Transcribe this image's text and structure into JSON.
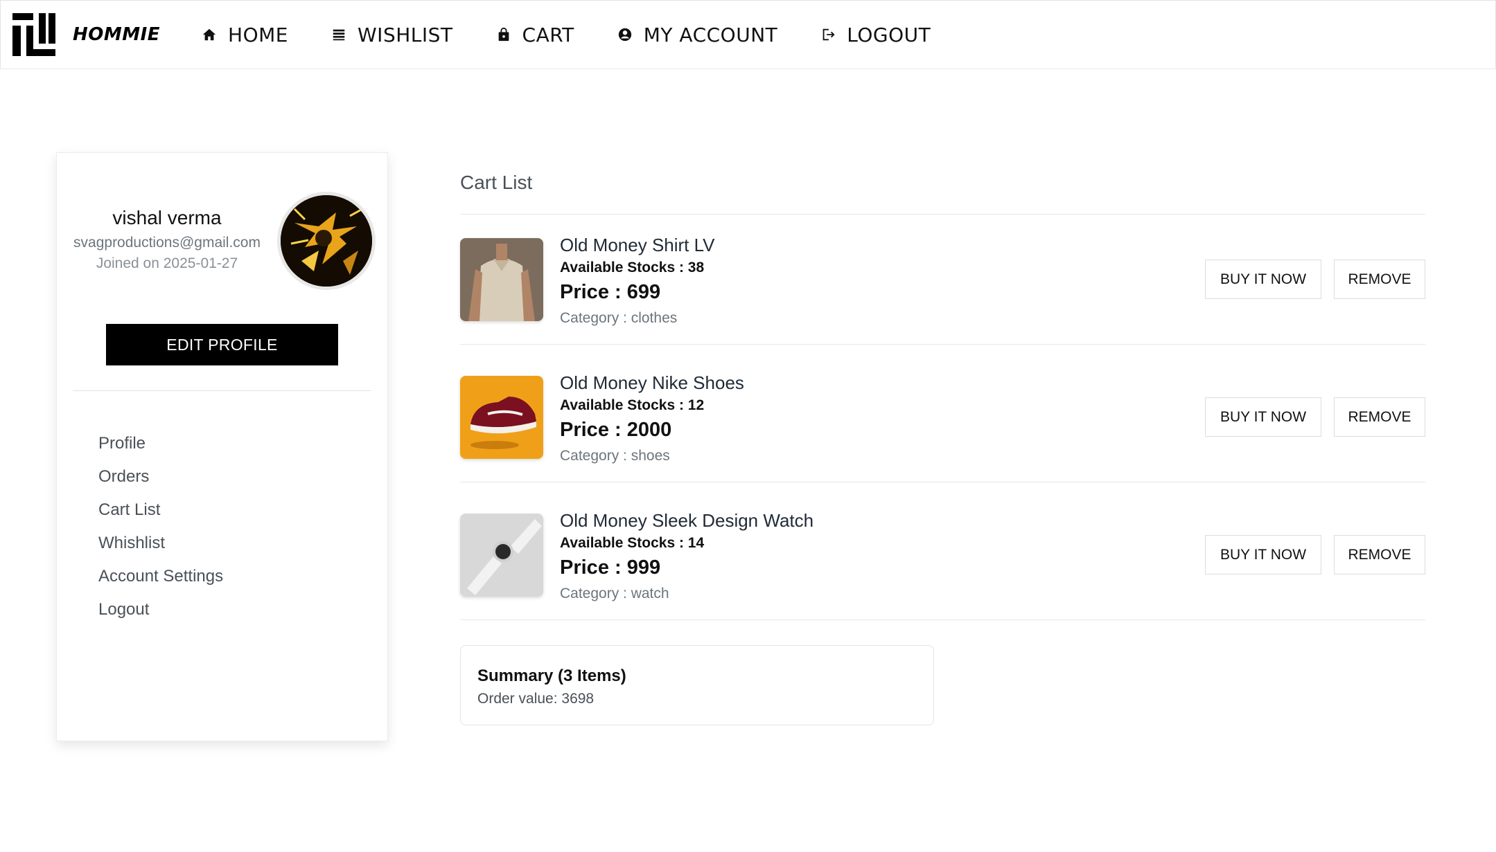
{
  "brand": {
    "name": "HOMMIE"
  },
  "nav": {
    "items": [
      {
        "label": "HOME",
        "icon": "home-icon"
      },
      {
        "label": "WISHLIST",
        "icon": "list-icon"
      },
      {
        "label": "CART",
        "icon": "shopping-bag-icon"
      },
      {
        "label": "MY ACCOUNT",
        "icon": "user-circle-icon"
      },
      {
        "label": "LOGOUT",
        "icon": "logout-icon"
      }
    ]
  },
  "profile": {
    "name": "vishal verma",
    "email": "svagproductions@gmail.com",
    "joined": "Joined on 2025-01-27",
    "edit_label": "EDIT PROFILE",
    "menu": [
      "Profile",
      "Orders",
      "Cart List",
      "Whishlist",
      "Account Settings",
      "Logout"
    ]
  },
  "cart": {
    "title": "Cart List",
    "items": [
      {
        "name": "Old Money Shirt LV",
        "stock": "Available Stocks : 38",
        "price": "Price : 699",
        "category": "Category : clothes",
        "buy_label": "BUY IT NOW",
        "remove_label": "REMOVE"
      },
      {
        "name": "Old Money Nike Shoes",
        "stock": "Available Stocks : 12",
        "price": "Price : 2000",
        "category": "Category : shoes",
        "buy_label": "BUY IT NOW",
        "remove_label": "REMOVE"
      },
      {
        "name": "Old Money Sleek Design Watch",
        "stock": "Available Stocks : 14",
        "price": "Price : 999",
        "category": "Category : watch",
        "buy_label": "BUY IT NOW",
        "remove_label": "REMOVE"
      }
    ],
    "summary": {
      "title": "Summary (3 Items)",
      "value": "Order value: 3698"
    }
  },
  "colors": {
    "primary": "#000000",
    "border": "#e3e3e3",
    "muted": "#6c757d"
  }
}
